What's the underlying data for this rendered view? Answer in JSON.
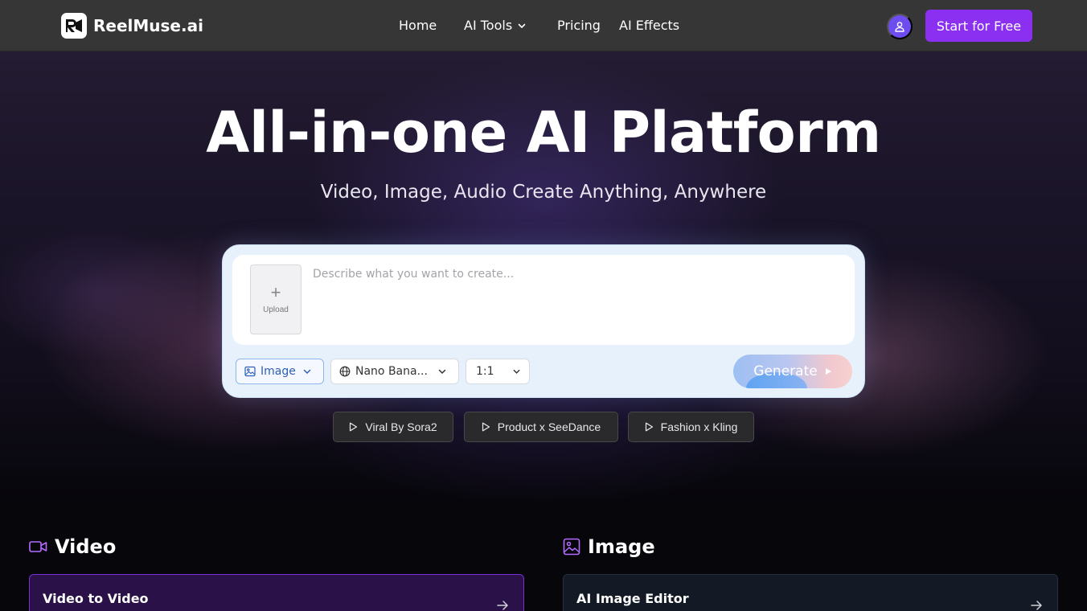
{
  "brand": {
    "name": "ReelMuse.ai",
    "logo_icon": "reelmuse-logo-icon"
  },
  "nav": {
    "items": [
      {
        "label": "Home"
      },
      {
        "label": "AI Tools",
        "has_dropdown": true
      },
      {
        "label": "Pricing"
      },
      {
        "label": "AI Effects"
      }
    ]
  },
  "header": {
    "cta_label": "Start for Free",
    "avatar_icon": "user-icon"
  },
  "hero": {
    "title": "All-in-one AI Platform",
    "subtitle": "Video, Image, Audio Create Anything, Anywhere"
  },
  "composer": {
    "upload_label": "Upload",
    "prompt_placeholder": "Describe what you want to create...",
    "prompt_value": "",
    "mode": "Image",
    "model": "Nano Bana...",
    "aspect_ratio": "1:1",
    "generate_label": "Generate"
  },
  "presets": [
    {
      "label": "Viral By Sora2"
    },
    {
      "label": "Product x SeeDance"
    },
    {
      "label": "Fashion x Kling"
    }
  ],
  "sections": {
    "video": {
      "title": "Video",
      "icon": "video-camera-icon",
      "first_card": "Video to Video"
    },
    "image": {
      "title": "Image",
      "icon": "image-icon",
      "first_card": "AI Image Editor"
    }
  },
  "colors": {
    "header_bg": "#363636",
    "accent_purple": "#8b2ff0",
    "avatar_bg": "#6d4cf0",
    "composer_bg": "#e6f1fb",
    "video_card_bg": "#2a1249",
    "video_card_border": "#7b2fd6",
    "image_card_bg": "#131a26"
  }
}
